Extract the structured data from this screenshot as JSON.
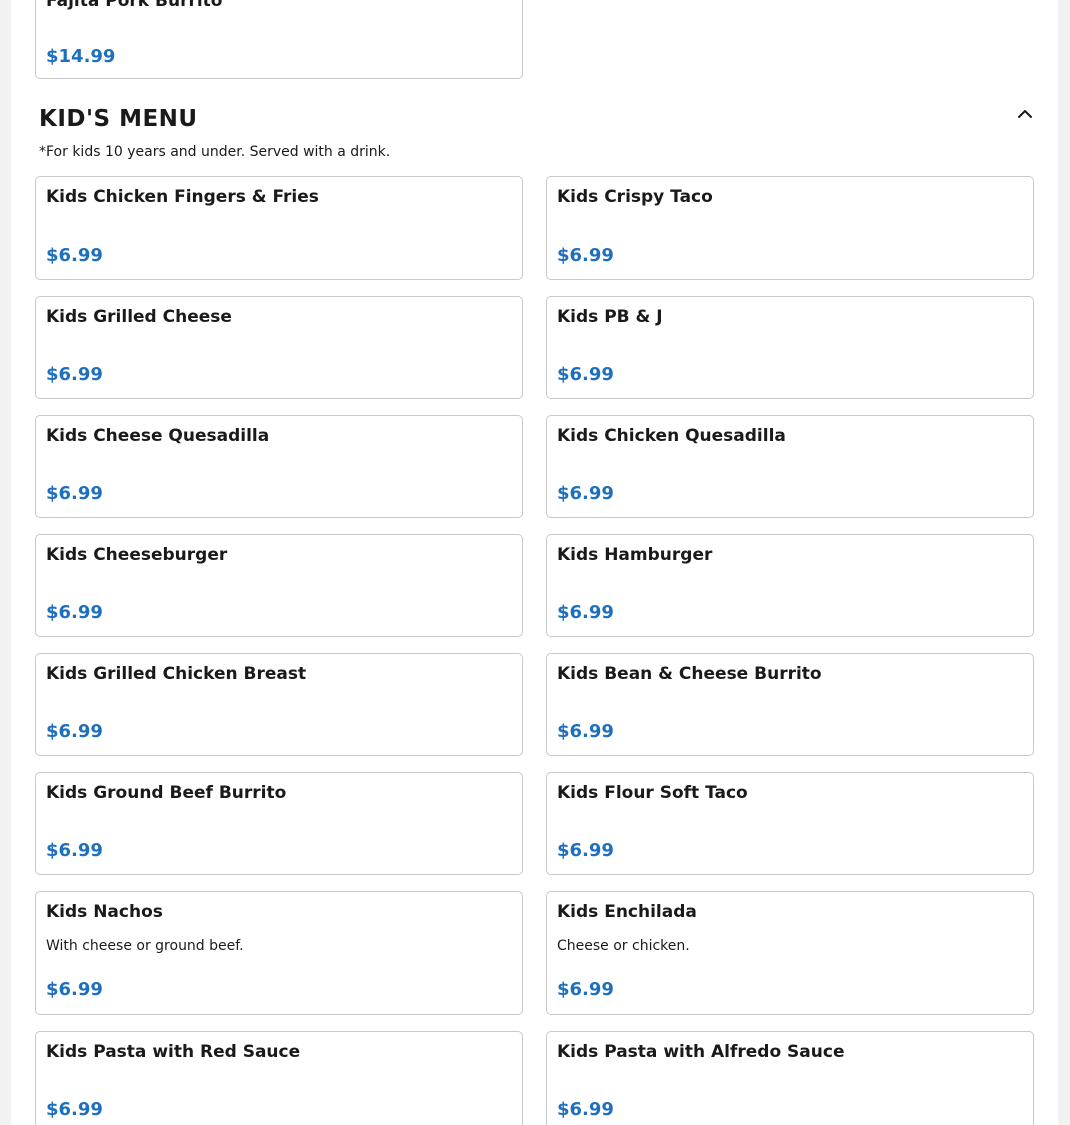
{
  "previous_item": {
    "name": "Fajita Pork Burrito",
    "price": "$14.99"
  },
  "section": {
    "title": "KID'S MENU",
    "note": "*For kids 10 years and under. Served with a drink.",
    "collapse_icon": "chevron-up-icon"
  },
  "items": [
    {
      "name": "Kids Chicken Fingers & Fries",
      "price": "$6.99"
    },
    {
      "name": "Kids Crispy Taco",
      "price": "$6.99"
    },
    {
      "name": "Kids Grilled Cheese",
      "price": "$6.99"
    },
    {
      "name": "Kids PB & J",
      "price": "$6.99"
    },
    {
      "name": "Kids Cheese Quesadilla",
      "price": "$6.99"
    },
    {
      "name": "Kids Chicken Quesadilla",
      "price": "$6.99"
    },
    {
      "name": "Kids Cheeseburger",
      "price": "$6.99"
    },
    {
      "name": "Kids Hamburger",
      "price": "$6.99"
    },
    {
      "name": "Kids Grilled Chicken Breast",
      "price": "$6.99"
    },
    {
      "name": "Kids Bean & Cheese Burrito",
      "price": "$6.99"
    },
    {
      "name": "Kids Ground Beef Burrito",
      "price": "$6.99"
    },
    {
      "name": "Kids Flour Soft Taco",
      "price": "$6.99"
    },
    {
      "name": "Kids Nachos",
      "description": "With cheese or ground beef.",
      "price": "$6.99"
    },
    {
      "name": "Kids Enchilada",
      "description": "Cheese or chicken.",
      "price": "$6.99"
    },
    {
      "name": "Kids Pasta with Red Sauce",
      "price": "$6.99"
    },
    {
      "name": "Kids Pasta with Alfredo Sauce",
      "price": "$6.99"
    }
  ],
  "colors": {
    "price": "#1f6fbf",
    "border": "#c9c9c9",
    "text": "#1a1a1a"
  }
}
